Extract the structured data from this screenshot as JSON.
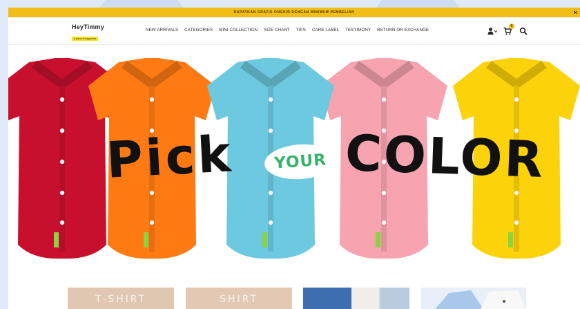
{
  "promo": {
    "text": "DAPATKAN GRATIS ONGKIR DENGAN MINIMUM PEMBELIAN",
    "close": "×"
  },
  "brand": {
    "name": "HeyTimmy",
    "tagline": "A piece of happiness"
  },
  "nav": {
    "items": [
      "NEW ARRIVALS",
      "CATEGORIES",
      "MINI COLLECTION",
      "SIZE CHART",
      "TIPS",
      "CARE LABEL",
      "TESTIMONY",
      "RETURN OR EXCHANGE"
    ]
  },
  "utils": {
    "account_icon": "user-icon",
    "cart_icon": "cart-icon",
    "cart_count": "0",
    "search_icon": "search-icon"
  },
  "hero": {
    "word_pick": "Pick",
    "word_your": "YOUR",
    "word_color": "COLOR",
    "shirt_colors": [
      "#c8102e",
      "#ff7a12",
      "#6cc9e0",
      "#f7a3b0",
      "#fcd20a"
    ]
  },
  "categories": [
    {
      "label": "T-SHIRT",
      "color": "#dfc7b1"
    },
    {
      "label": "SHIRT",
      "color": "#e3c9b4"
    }
  ]
}
